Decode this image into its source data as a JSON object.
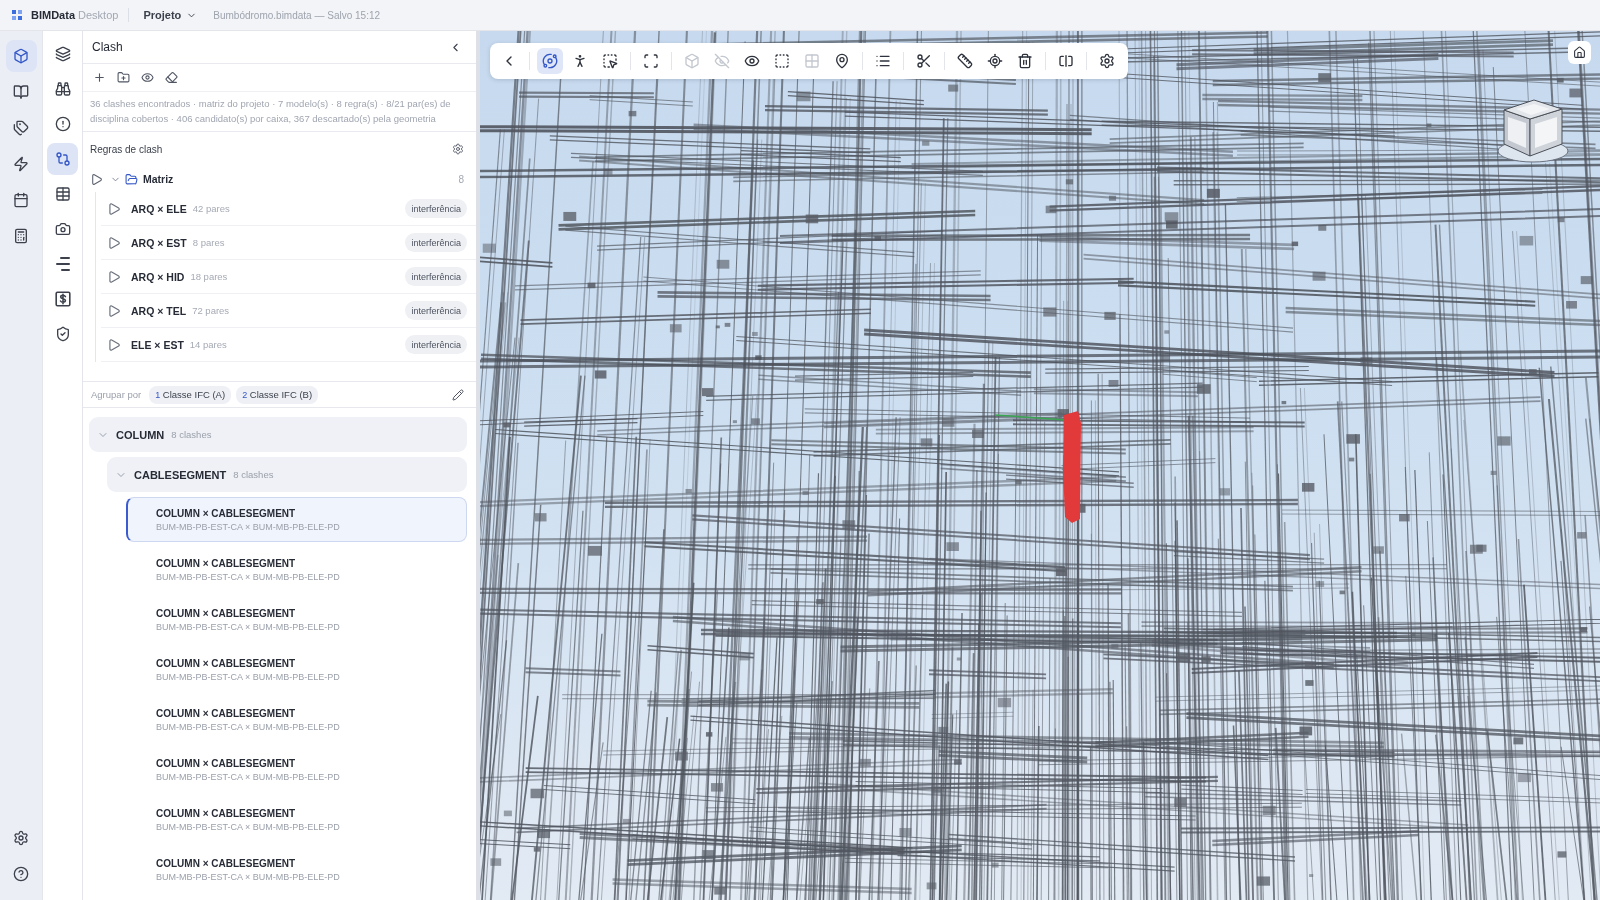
{
  "top_bar": {
    "brand": "BIMData",
    "edition": "Desktop",
    "menu": "Projeto",
    "document": "Bumbódromo.bimdata — Salvo 15:12"
  },
  "primary_rail": {
    "items": [
      {
        "kind": "model",
        "selected": true
      },
      {
        "kind": "documents",
        "selected": false
      },
      {
        "kind": "tags",
        "selected": false
      },
      {
        "kind": "automation",
        "selected": false
      },
      {
        "kind": "schedule",
        "selected": false
      },
      {
        "kind": "quantities",
        "selected": false
      }
    ],
    "footer": [
      {
        "kind": "settings",
        "selected": false
      },
      {
        "kind": "help",
        "selected": false
      }
    ]
  },
  "secondary_rail": {
    "items": [
      {
        "kind": "layers",
        "selected": false
      },
      {
        "kind": "search",
        "selected": false
      },
      {
        "kind": "issues",
        "selected": false
      },
      {
        "kind": "clash",
        "selected": true
      },
      {
        "kind": "tables",
        "selected": false
      },
      {
        "kind": "snapshots",
        "selected": false
      },
      {
        "kind": "outline",
        "selected": false
      },
      {
        "kind": "costs",
        "selected": false
      },
      {
        "kind": "validation",
        "selected": false
      }
    ]
  },
  "panel": {
    "title": "Clash",
    "tools": [
      {
        "kind": "add"
      },
      {
        "kind": "add_folder"
      },
      {
        "kind": "show"
      },
      {
        "kind": "clear"
      }
    ],
    "summary": "36 clashes encontrados · matriz do projeto · 7 modelo(s) · 8 regra(s) · 8/21 par(es) de disciplina cobertos · 406 candidato(s) por caixa, 367 descartado(s) pela geometria",
    "rules_title": "Regras de clash",
    "rule_folders": [
      {
        "name": "Matriz",
        "count": "8",
        "expanded": true,
        "rules": [
          {
            "name": "ARQ × ELE",
            "pairs": "42 pares",
            "type": "interferência"
          },
          {
            "name": "ARQ × EST",
            "pairs": "8 pares",
            "type": "interferência"
          },
          {
            "name": "ARQ × HID",
            "pairs": "18 pares",
            "type": "interferência"
          },
          {
            "name": "ARQ × TEL",
            "pairs": "72 pares",
            "type": "interferência"
          },
          {
            "name": "ELE × EST",
            "pairs": "14 pares",
            "type": "interferência"
          }
        ]
      }
    ],
    "group_by": {
      "label": "Agrupar por",
      "fields": [
        {
          "index": "1",
          "label": "Classe IFC (A)"
        },
        {
          "index": "2",
          "label": "Classe IFC (B)"
        }
      ]
    },
    "groups": [
      {
        "name": "COLUMN",
        "count": "8 clashes",
        "expanded": true,
        "children": [
          {
            "name": "CABLESEGMENT",
            "count": "8 clashes",
            "expanded": true,
            "clashes": [
              {
                "title": "COLUMN × CABLESEGMENT",
                "models": "BUM-MB-PB-EST-CA × BUM-MB-PB-ELE-PD",
                "selected": true
              },
              {
                "title": "COLUMN × CABLESEGMENT",
                "models": "BUM-MB-PB-EST-CA × BUM-MB-PB-ELE-PD",
                "selected": false
              },
              {
                "title": "COLUMN × CABLESEGMENT",
                "models": "BUM-MB-PB-EST-CA × BUM-MB-PB-ELE-PD",
                "selected": false
              },
              {
                "title": "COLUMN × CABLESEGMENT",
                "models": "BUM-MB-PB-EST-CA × BUM-MB-PB-ELE-PD",
                "selected": false
              },
              {
                "title": "COLUMN × CABLESEGMENT",
                "models": "BUM-MB-PB-EST-CA × BUM-MB-PB-ELE-PD",
                "selected": false
              },
              {
                "title": "COLUMN × CABLESEGMENT",
                "models": "BUM-MB-PB-EST-CA × BUM-MB-PB-ELE-PD",
                "selected": false
              },
              {
                "title": "COLUMN × CABLESEGMENT",
                "models": "BUM-MB-PB-EST-CA × BUM-MB-PB-ELE-PD",
                "selected": false
              },
              {
                "title": "COLUMN × CABLESEGMENT",
                "models": "BUM-MB-PB-EST-CA × BUM-MB-PB-ELE-PD",
                "selected": false
              }
            ]
          }
        ]
      }
    ]
  },
  "viewer": {
    "toolbar": [
      [
        {
          "kind": "back",
          "selected": false,
          "disabled": false
        }
      ],
      [
        {
          "kind": "orbit",
          "selected": true,
          "disabled": false
        },
        {
          "kind": "walk",
          "selected": false,
          "disabled": false
        },
        {
          "kind": "box_select",
          "selected": false,
          "disabled": false
        }
      ],
      [
        {
          "kind": "fit",
          "selected": false,
          "disabled": false
        }
      ],
      [
        {
          "kind": "isolate",
          "selected": false,
          "disabled": true
        },
        {
          "kind": "hide",
          "selected": false,
          "disabled": true
        },
        {
          "kind": "show",
          "selected": false,
          "disabled": false
        },
        {
          "kind": "area_select",
          "selected": false,
          "disabled": false
        },
        {
          "kind": "sections",
          "selected": false,
          "disabled": true
        },
        {
          "kind": "markers",
          "selected": false,
          "disabled": false
        }
      ],
      [
        {
          "kind": "tree",
          "selected": false,
          "disabled": false
        }
      ],
      [
        {
          "kind": "cut",
          "selected": false,
          "disabled": false
        }
      ],
      [
        {
          "kind": "measure",
          "selected": false,
          "disabled": false
        },
        {
          "kind": "locate",
          "selected": false,
          "disabled": false
        },
        {
          "kind": "delete",
          "selected": false,
          "disabled": false
        }
      ],
      [
        {
          "kind": "compare",
          "selected": false,
          "disabled": false
        }
      ],
      [
        {
          "kind": "settings",
          "selected": false,
          "disabled": false
        }
      ]
    ]
  }
}
